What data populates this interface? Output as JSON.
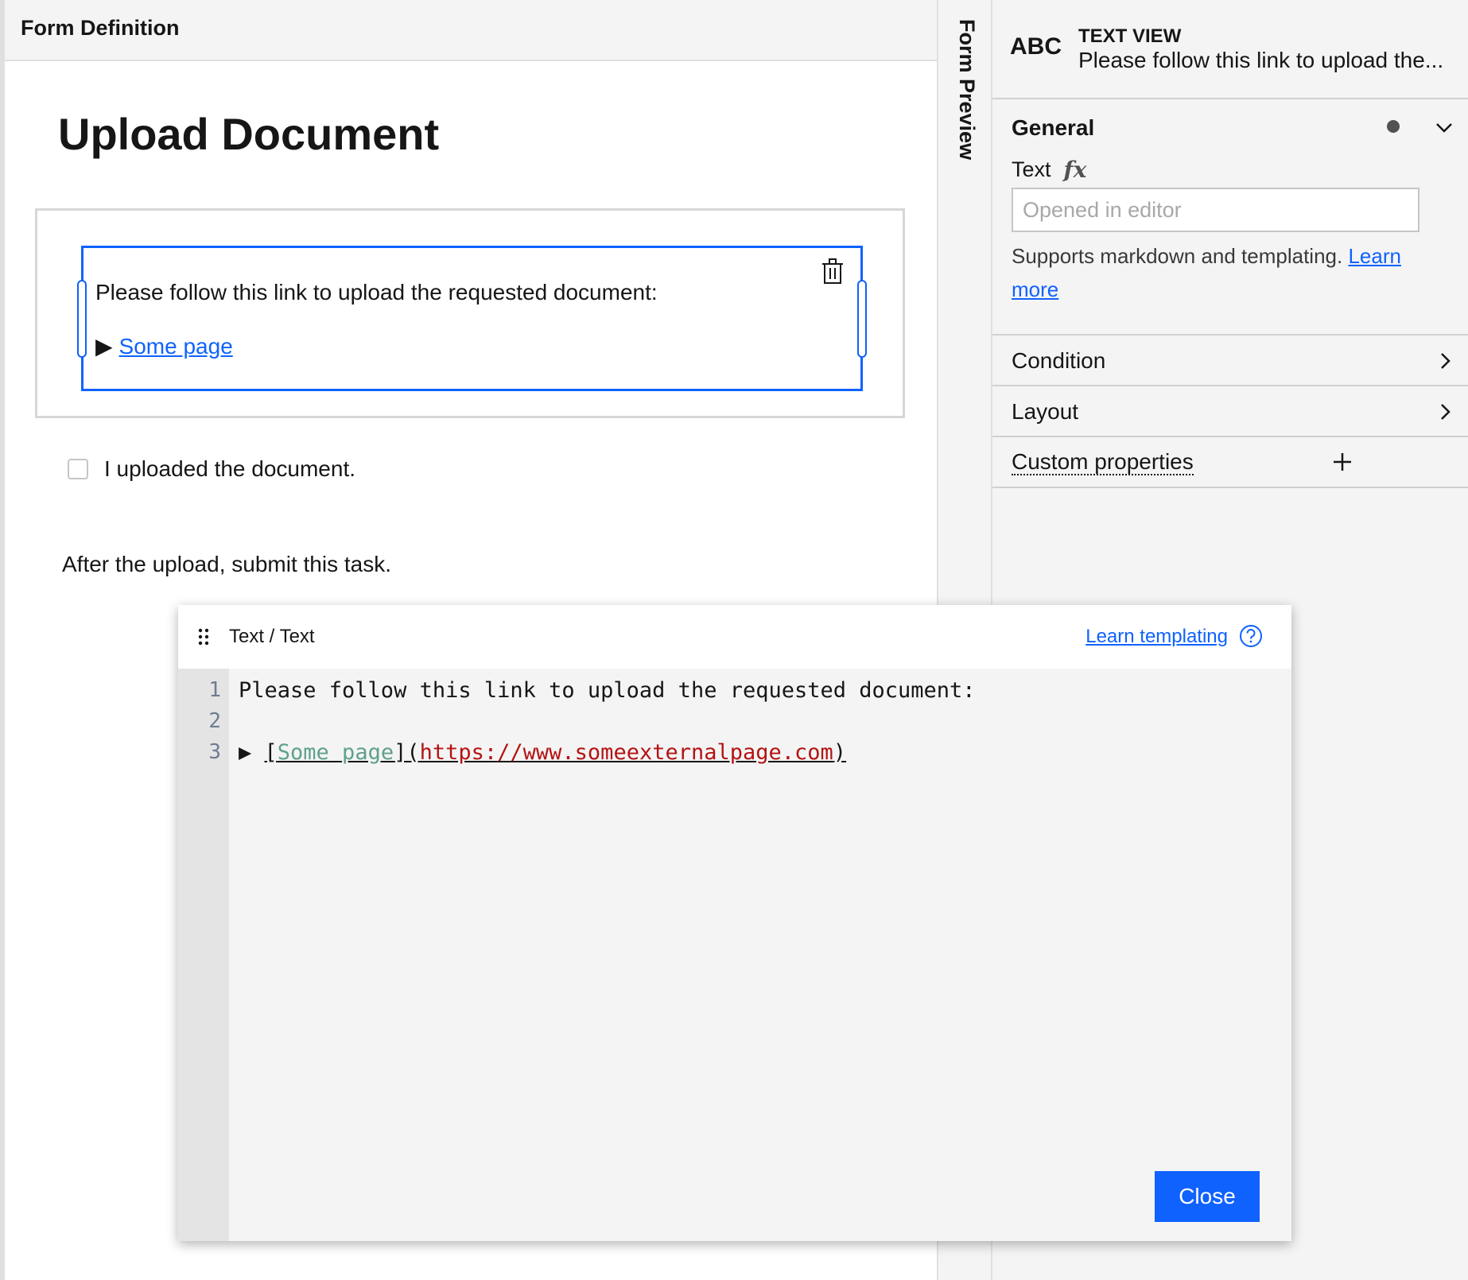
{
  "form_definition": {
    "header_title": "Form Definition",
    "form_title": "Upload Document",
    "selected_text": {
      "line1": "Please follow this link to upload the requested document:",
      "arrow": "▶",
      "link_label": "Some page"
    },
    "checkbox_label": "I uploaded the document.",
    "after_text": "After the upload, submit this task."
  },
  "preview_tab": {
    "label": "Form Preview"
  },
  "properties": {
    "icon_text": "ABC",
    "component_type": "TEXT VIEW",
    "component_desc": "Please follow this link to upload the...",
    "general": {
      "title": "General",
      "text_label": "Text",
      "fx_label": "fx",
      "input_placeholder": "Opened in editor",
      "helper_text": "Supports markdown and templating.",
      "helper_link": "Learn more"
    },
    "sections": {
      "condition": "Condition",
      "layout": "Layout",
      "custom_properties": "Custom properties"
    }
  },
  "editor": {
    "title": "Text / Text",
    "learn_link": "Learn templating",
    "line_numbers": [
      "1",
      "2",
      "3"
    ],
    "line1": "Please follow this link to upload the requested document:",
    "line3_arrow": "▶ ",
    "line3_open": "[",
    "line3_link": "Some page",
    "line3_mid": "](",
    "line3_url": "https://www.someexternalpage.com",
    "line3_close": ")",
    "close_label": "Close"
  },
  "colors": {
    "accent": "#0f62fe",
    "link_syntax": "#5fa08d",
    "url_syntax": "#b31412"
  }
}
